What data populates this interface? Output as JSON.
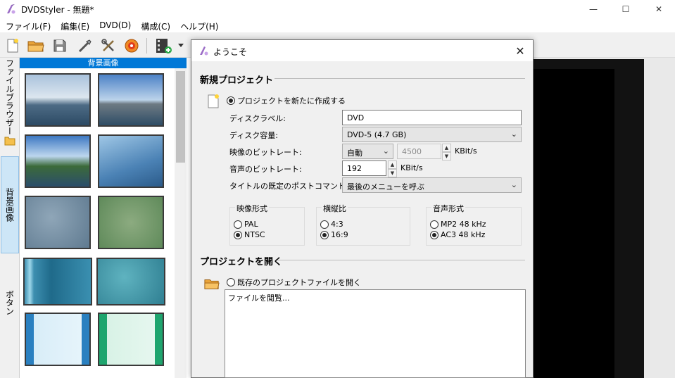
{
  "window": {
    "title": "DVDStyler - 無題*",
    "minimize_glyph": "—",
    "maximize_glyph": "☐",
    "close_glyph": "✕"
  },
  "menu": [
    "ファイル(F)",
    "編集(E)",
    "DVD(D)",
    "構成(C)",
    "ヘルプ(H)"
  ],
  "toolbar": {
    "icons": [
      "new-file-icon",
      "open-folder-icon",
      "save-icon",
      "settings-wand-icon",
      "tools-icon",
      "burn-disc-icon",
      "add-video-icon",
      "dropdown-arrow-icon"
    ]
  },
  "side_tabs": [
    {
      "label": "ファイルブラウザー",
      "active": false
    },
    {
      "label": "背景画像",
      "active": true
    },
    {
      "label": "ボタン",
      "active": false
    }
  ],
  "gallery": {
    "header": "背景画像",
    "thumbnails": [
      "sea-sky",
      "harbor-boat",
      "lake-shore",
      "blue-haze",
      "blue-gray-texture",
      "green-texture",
      "teal-stripes",
      "teal-water-texture",
      "light-blue-bars",
      "light-green-bars"
    ]
  },
  "dialog": {
    "title": "ようこそ",
    "close_glyph": "✕",
    "new_project": {
      "heading": "新規プロジェクト",
      "option_label": "プロジェクトを新たに作成する",
      "disc_label": {
        "label": "ディスクラベル:",
        "value": "DVD"
      },
      "disc_capacity": {
        "label": "ディスク容量:",
        "value": "DVD-5 (4.7 GB)"
      },
      "video_bitrate": {
        "label": "映像のビットレート:",
        "mode": "自動",
        "value": "4500",
        "unit": "KBit/s"
      },
      "audio_bitrate": {
        "label": "音声のビットレート:",
        "value": "192",
        "unit": "KBit/s"
      },
      "post_command": {
        "label": "タイトルの既定のポストコマンド:",
        "value": "最後のメニューを呼ぶ"
      },
      "video_format": {
        "title": "映像形式",
        "options": [
          {
            "label": "PAL",
            "checked": false
          },
          {
            "label": "NTSC",
            "checked": true
          }
        ]
      },
      "aspect_ratio": {
        "title": "横縦比",
        "options": [
          {
            "label": "4:3",
            "checked": false
          },
          {
            "label": "16:9",
            "checked": true
          }
        ]
      },
      "audio_format": {
        "title": "音声形式",
        "options": [
          {
            "label": "MP2 48 kHz",
            "checked": false
          },
          {
            "label": "AC3 48 kHz",
            "checked": true
          }
        ]
      }
    },
    "open_project": {
      "heading": "プロジェクトを開く",
      "option_label": "既存のプロジェクトファイルを開く",
      "browse_text": "ファイルを閲覧..."
    }
  }
}
